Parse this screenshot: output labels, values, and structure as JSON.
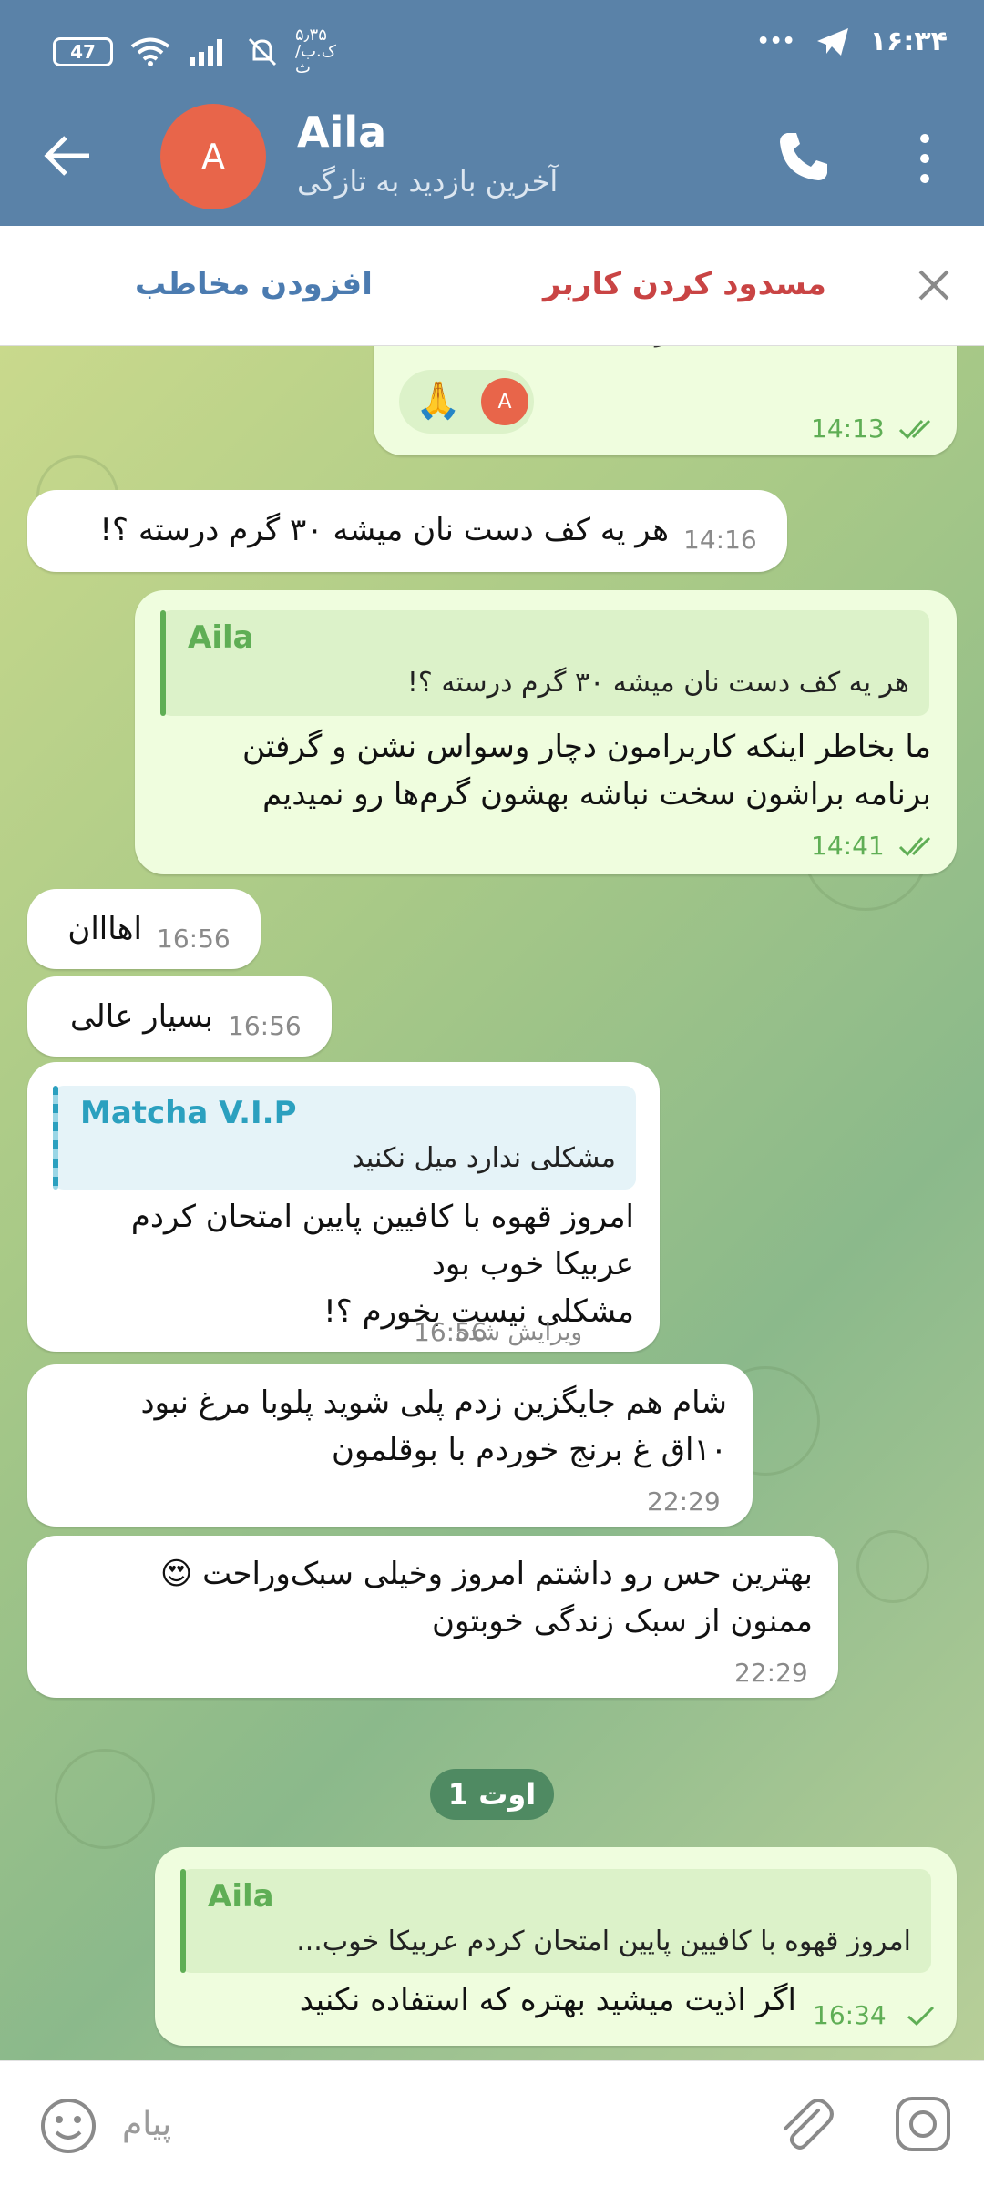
{
  "status_bar": {
    "battery": "47",
    "data_speed": "۵٫۳۵ ک.ب/ث",
    "time": "۱۶:۳۴",
    "dots": "•••"
  },
  "header": {
    "avatar_letter": "A",
    "title": "Aila",
    "status": "آخرین بازدید به تازگی"
  },
  "action_bar": {
    "add_contact": "افزودن مخاطب",
    "block_user": "مسدود کردن کاربر"
  },
  "messages": [
    {
      "text": "مشکلی ندارد میل نکنید",
      "reaction_avatar": "A",
      "reaction": "🙏",
      "time": "14:13"
    },
    {
      "text": "هر یه کف دست نان میشه ۳۰ گرم درسته ؟!",
      "time": "14:16"
    },
    {
      "reply_name": "Aila",
      "reply_text": "هر یه کف دست نان میشه ۳۰ گرم درسته ؟!",
      "text": "ما بخاطر اینکه کاربرامون دچار وسواس نشن و گرفتن\nبرنامه براشون سخت نباشه بهشون گرم‌ها رو نمیدیم",
      "time": "14:41"
    },
    {
      "text": "اهااان",
      "time": "16:56"
    },
    {
      "text": "بسیار عالی",
      "time": "16:56"
    },
    {
      "reply_name": "Matcha V.I.P",
      "reply_text": "مشکلی ندارد میل نکنید",
      "text": "امروز قهوه با کافیین پایین امتحان کردم\nعربیکا خوب بود\nمشکلی نیست بخورم ؟!",
      "time": "16:56",
      "edited": "ویرایش شده"
    },
    {
      "text": "شام هم جایگزین زدم پلی شوید پلوبا مرغ نبود\n۱۰اق غ برنج خوردم با بوقلمون",
      "time": "22:29"
    },
    {
      "text": "بهترین حس رو داشتم امروز وخیلی سبک‌وراحت 😍\nممنون از سبک زندگی خوبتون",
      "time": "22:29"
    },
    {
      "reply_name": "Aila",
      "reply_text": "امروز قهوه با کافیین پایین امتحان کردم  عربیکا خوب...",
      "text": "اگر اذیت میشید بهتره که استفاده نکنید",
      "time": "16:34"
    }
  ],
  "date_divider": "1 اوت",
  "input": {
    "placeholder": "پیام"
  },
  "colors": {
    "header": "#5a82a8",
    "outgoing": "#effdde",
    "incoming": "#ffffff",
    "accent_green": "#5fae55",
    "block_red": "#c94444",
    "link_blue": "#4b7bb0",
    "reply_cyan": "#2ba0bf"
  },
  "icons": [
    "back-arrow-icon",
    "phone-icon",
    "more-vertical-icon",
    "close-icon",
    "double-check-icon",
    "single-check-icon",
    "emoji-icon",
    "paperclip-icon",
    "camera-icon",
    "wifi-icon",
    "signal-icon",
    "mute-bell-icon",
    "telegram-plane-icon"
  ]
}
